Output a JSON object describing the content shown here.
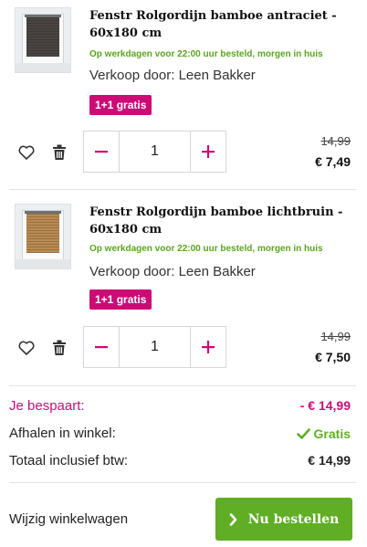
{
  "items": [
    {
      "title": "Fenstr Rolgordijn bamboe antraciet - 60x180 cm",
      "delivery": "Op werkdagen voor 22:00 uur besteld, morgen in huis",
      "seller": "Verkoop door: Leen Bakker",
      "promo": "1+1 gratis",
      "quantity": "1",
      "old_price": "14,99",
      "new_price": "€ 7,49",
      "blind_color": "#4a4542"
    },
    {
      "title": "Fenstr Rolgordijn bamboe lichtbruin - 60x180 cm",
      "delivery": "Op werkdagen voor 22:00 uur besteld, morgen in huis",
      "seller": "Verkoop door: Leen Bakker",
      "promo": "1+1 gratis",
      "quantity": "1",
      "old_price": "14,99",
      "new_price": "€ 7,50",
      "blind_color": "#b98a52"
    }
  ],
  "summary": {
    "savings_label": "Je bespaart:",
    "savings_value": "- € 14,99",
    "pickup_label": "Afhalen in winkel:",
    "pickup_value": "Gratis",
    "total_label": "Totaal inclusief btw:",
    "total_value": "€ 14,99"
  },
  "actions": {
    "edit_cart": "Wijzig winkelwagen",
    "checkout": "Nu bestellen"
  },
  "colors": {
    "brand_pink": "#cc0b75",
    "green": "#5fae26"
  },
  "icons": [
    "heart-icon",
    "trash-icon",
    "minus-icon",
    "plus-icon",
    "check-icon",
    "chevron-right-icon"
  ]
}
